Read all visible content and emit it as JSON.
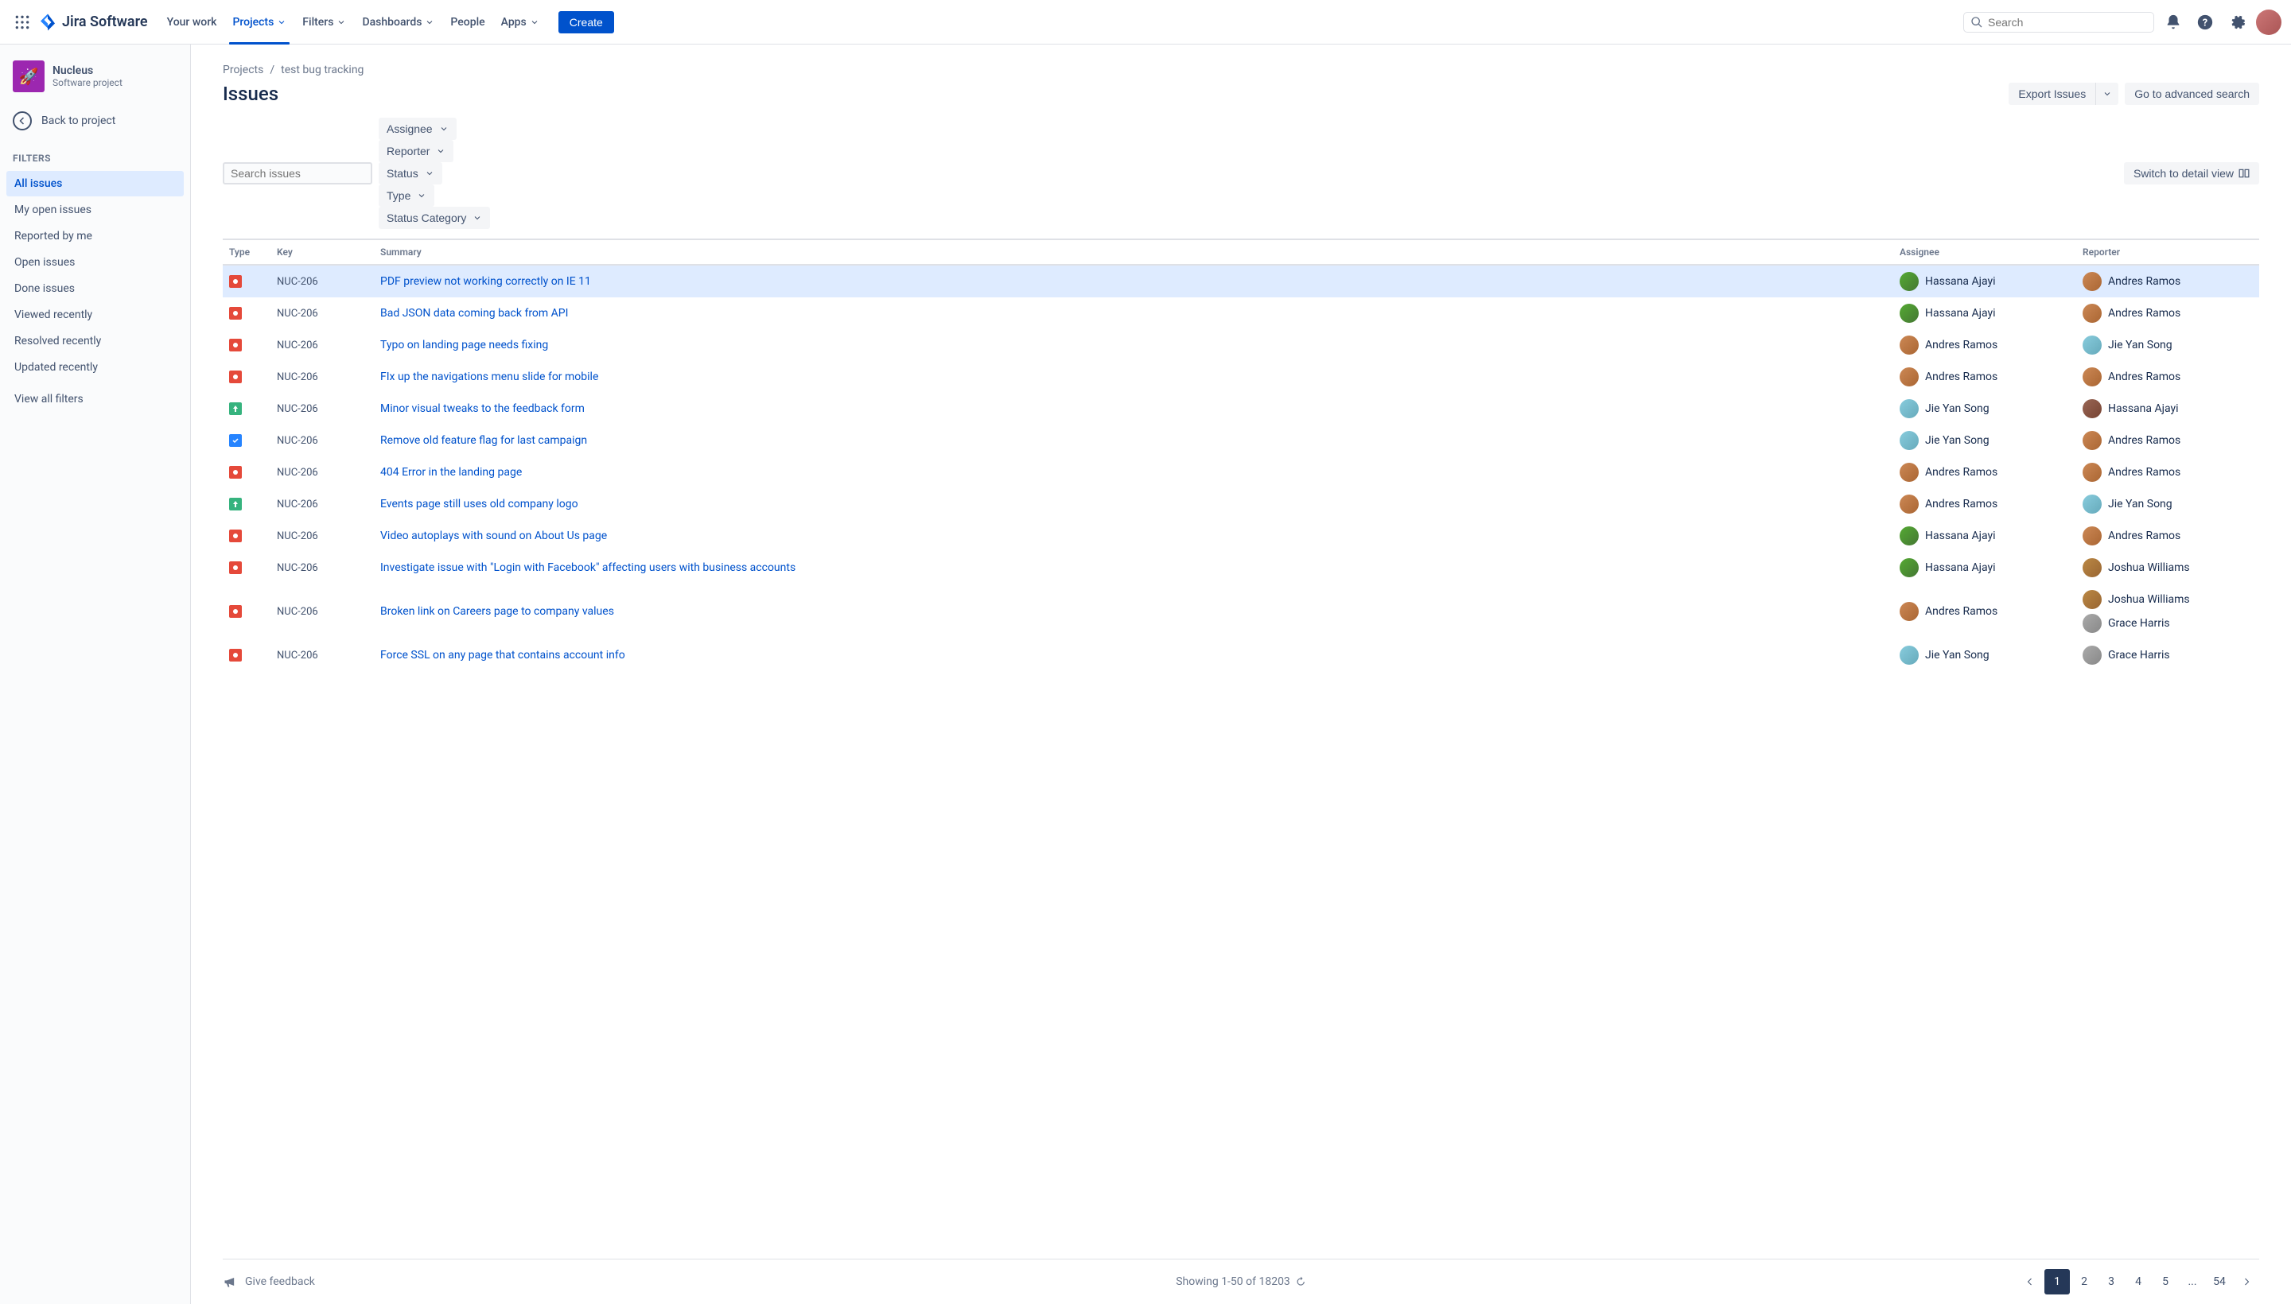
{
  "nav": {
    "product": "Jira Software",
    "items": [
      "Your work",
      "Projects",
      "Filters",
      "Dashboards",
      "People",
      "Apps"
    ],
    "active_index": 1,
    "create": "Create",
    "search_placeholder": "Search"
  },
  "sidebar": {
    "project_name": "Nucleus",
    "project_type": "Software project",
    "back": "Back to project",
    "heading": "Filters",
    "filters": [
      "All issues",
      "My open issues",
      "Reported by me",
      "Open issues",
      "Done issues",
      "Viewed recently",
      "Resolved recently",
      "Updated recently"
    ],
    "active_filter": 0,
    "view_all": "View all filters"
  },
  "breadcrumb": {
    "parent": "Projects",
    "current": "test bug tracking"
  },
  "page": {
    "title": "Issues",
    "export": "Export Issues",
    "advanced": "Go to advanced search",
    "switch_view": "Switch to detail view"
  },
  "filter_bar": {
    "search_placeholder": "Search issues",
    "dropdowns": [
      "Assignee",
      "Reporter",
      "Status",
      "Type",
      "Status Category"
    ]
  },
  "table": {
    "columns": [
      "Type",
      "Key",
      "Summary",
      "Assignee",
      "Reporter"
    ],
    "rows": [
      {
        "type": "bug",
        "key": "NUC-206",
        "summary": "PDF preview not working correctly on IE 11",
        "assignee": "Hassana Ajayi",
        "a_av": "pa1",
        "reporter": "Andres Ramos",
        "r_av": "pa2",
        "selected": true
      },
      {
        "type": "bug",
        "key": "NUC-206",
        "summary": "Bad JSON data coming back from API",
        "assignee": "Hassana Ajayi",
        "a_av": "pa1",
        "reporter": "Andres Ramos",
        "r_av": "pa2"
      },
      {
        "type": "bug",
        "key": "NUC-206",
        "summary": "Typo on landing page needs fixing",
        "assignee": "Andres Ramos",
        "a_av": "pa2",
        "reporter": "Jie Yan Song",
        "r_av": "pa3"
      },
      {
        "type": "bug",
        "key": "NUC-206",
        "summary": "FIx up the navigations menu slide for mobile",
        "assignee": "Andres Ramos",
        "a_av": "pa2",
        "reporter": "Andres Ramos",
        "r_av": "pa2"
      },
      {
        "type": "imp",
        "key": "NUC-206",
        "summary": "Minor visual tweaks to the feedback form",
        "assignee": "Jie Yan Song",
        "a_av": "pa3",
        "reporter": "Hassana Ajayi",
        "r_av": "pa4"
      },
      {
        "type": "task",
        "key": "NUC-206",
        "summary": "Remove old feature flag for last campaign",
        "assignee": "Jie Yan Song",
        "a_av": "pa3",
        "reporter": "Andres Ramos",
        "r_av": "pa2"
      },
      {
        "type": "bug",
        "key": "NUC-206",
        "summary": "404 Error in the landing page",
        "assignee": "Andres Ramos",
        "a_av": "pa2",
        "reporter": "Andres Ramos",
        "r_av": "pa2"
      },
      {
        "type": "imp",
        "key": "NUC-206",
        "summary": "Events page still uses old company logo",
        "assignee": "Andres Ramos",
        "a_av": "pa2",
        "reporter": "Jie Yan Song",
        "r_av": "pa3"
      },
      {
        "type": "bug",
        "key": "NUC-206",
        "summary": "Video autoplays with sound on About Us page",
        "assignee": "Hassana Ajayi",
        "a_av": "pa1",
        "reporter": "Andres Ramos",
        "r_av": "pa2"
      },
      {
        "type": "bug",
        "key": "NUC-206",
        "summary": "Investigate issue with \"Login with Facebook\" affecting users with business accounts",
        "assignee": "Hassana Ajayi",
        "a_av": "pa1",
        "reporter": "Joshua Williams",
        "r_av": "pa5"
      },
      {
        "type": "bug",
        "key": "NUC-206",
        "summary": "Broken link on Careers page to company values",
        "assignee": "Andres Ramos",
        "a_av": "pa2",
        "reporter": "Joshua Williams",
        "r_av": "pa5",
        "extra_reporter": "Grace Harris",
        "extra_av": "pa6"
      },
      {
        "type": "bug",
        "key": "NUC-206",
        "summary": "Force SSL on any page that contains account info",
        "assignee": "Jie Yan Song",
        "a_av": "pa3",
        "reporter": "Grace Harris",
        "r_av": "pa6"
      }
    ]
  },
  "footer": {
    "feedback": "Give feedback",
    "showing": "Showing 1-50 of 18203",
    "pages": [
      "1",
      "2",
      "3",
      "4",
      "5",
      "...",
      "54"
    ],
    "active_page": 0
  }
}
